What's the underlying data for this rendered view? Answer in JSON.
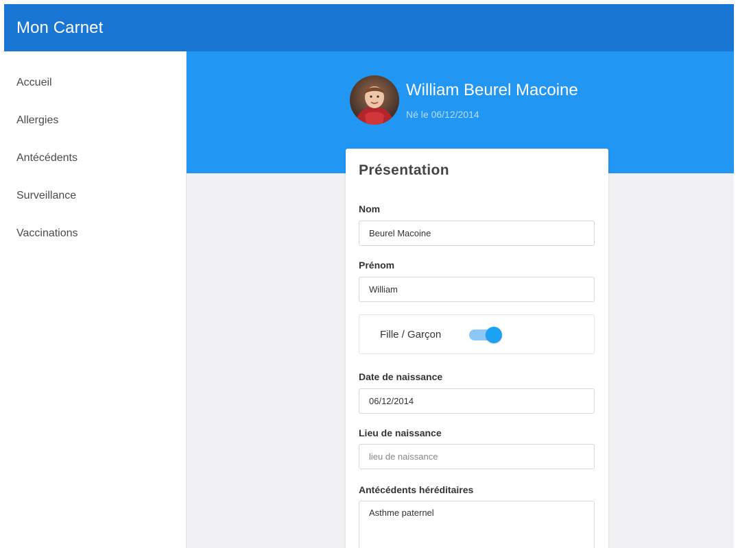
{
  "header": {
    "title": "Mon Carnet"
  },
  "sidebar": {
    "items": [
      {
        "label": "Accueil"
      },
      {
        "label": "Allergies"
      },
      {
        "label": "Antécédents"
      },
      {
        "label": "Surveillance"
      },
      {
        "label": "Vaccinations"
      }
    ]
  },
  "profile": {
    "name": "William Beurel Macoine",
    "birth_line": "Né le 06/12/2014"
  },
  "card": {
    "title": "Présentation",
    "nom": {
      "label": "Nom",
      "value": "Beurel Macoine"
    },
    "prenom": {
      "label": "Prénom",
      "value": "William"
    },
    "gender": {
      "label": "Fille / Garçon",
      "checked": true
    },
    "date_naissance": {
      "label": "Date de naissance",
      "value": "06/12/2014"
    },
    "lieu_naissance": {
      "label": "Lieu de naissance",
      "value": "",
      "placeholder": "lieu de naissance"
    },
    "antecedents": {
      "label": "Antécédents héréditaires",
      "value": "Asthme paternel"
    }
  },
  "colors": {
    "header": "#1976d2",
    "hero": "#2196f3",
    "toggle_on": "#1da1f2",
    "background": "#f1f1f3"
  }
}
